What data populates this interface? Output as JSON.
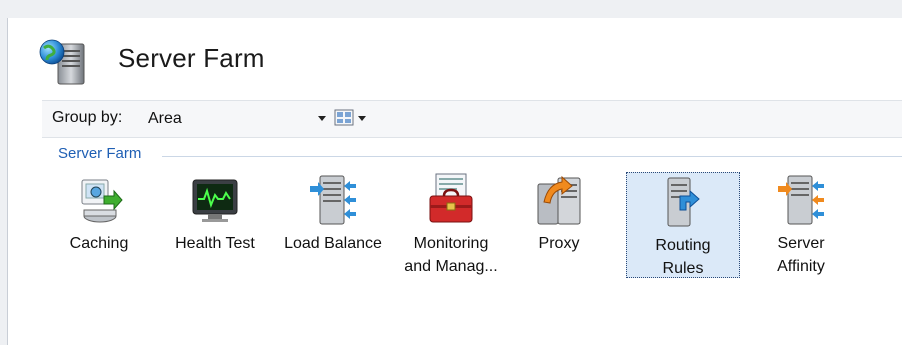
{
  "header": {
    "title": "Server Farm",
    "icon": "server-globe-icon"
  },
  "toolbar": {
    "group_by_label": "Group by:",
    "group_by_value": "Area",
    "view_icon": "view-mode-icon"
  },
  "group": {
    "title": "Server Farm"
  },
  "features": [
    {
      "label": "Caching",
      "icon": "caching-icon"
    },
    {
      "label": "Health Test",
      "icon": "health-test-icon"
    },
    {
      "label": "Load Balance",
      "icon": "load-balance-icon"
    },
    {
      "label": "Monitoring and Manag...",
      "label_line1": "Monitoring",
      "label_line2": "and Manag...",
      "icon": "monitoring-toolbox-icon"
    },
    {
      "label": "Proxy",
      "icon": "proxy-icon"
    },
    {
      "label": "Routing Rules",
      "label_line1": "Routing",
      "label_line2": "Rules",
      "icon": "routing-rules-icon",
      "selected": true
    },
    {
      "label": "Server Affinity",
      "label_line1": "Server",
      "label_line2": "Affinity",
      "icon": "server-affinity-icon"
    }
  ]
}
